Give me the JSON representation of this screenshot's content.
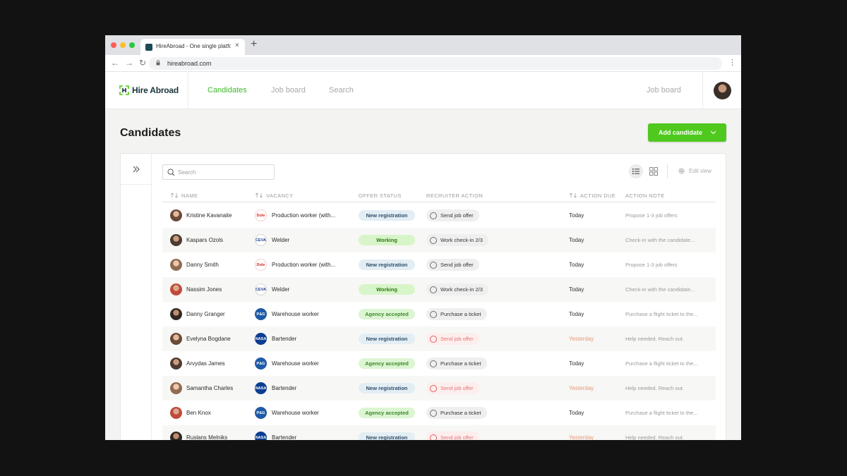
{
  "browser": {
    "tab_title": "HireAbroad - One single platform",
    "tab_close": "×",
    "new_tab": "+",
    "url": "hireabroad.com"
  },
  "app": {
    "logo": "Hire Abroad",
    "nav": [
      "Candidates",
      "Job board",
      "Search"
    ],
    "nav_right": "Job board"
  },
  "page": {
    "title": "Candidates",
    "add_button": "Add candidate"
  },
  "toolbar": {
    "search_placeholder": "Search",
    "edit_view": "Edit view"
  },
  "columns": [
    "NAME",
    "VACANCY",
    "OFFER STATUS",
    "RECRUITER ACTION",
    "ACTION DUE",
    "ACTION NOTE"
  ],
  "rows": [
    {
      "name": "Kristine Kavanaite",
      "company": "Dole",
      "vacancy": "Production worker (with...",
      "status": "New registration",
      "action": "Send job offer",
      "due": "Today",
      "note": "Propose 1-3 job offers"
    },
    {
      "name": "Kaspars Ozols",
      "company": "CEVA",
      "vacancy": "Welder",
      "status": "Working",
      "action": "Work check-in 2/3",
      "due": "Today",
      "note": "Check-in with the candidate..."
    },
    {
      "name": "Danny Smith",
      "company": "Dole",
      "vacancy": "Production worker (with...",
      "status": "New registration",
      "action": "Send job offer",
      "due": "Today",
      "note": "Propose 1-3 job offers"
    },
    {
      "name": "Nassim Jones",
      "company": "CEVA",
      "vacancy": "Welder",
      "status": "Working",
      "action": "Work check-in 2/3",
      "due": "Today",
      "note": "Check-in with the candidate..."
    },
    {
      "name": "Danny Granger",
      "company": "P&G",
      "vacancy": "Warehouse worker",
      "status": "Agency accepted",
      "action": "Purchase a ticket",
      "due": "Today",
      "note": "Purchase a flight ticket to the..."
    },
    {
      "name": "Evelyna Bogdane",
      "company": "NASA",
      "vacancy": "Bartender",
      "status": "New registration",
      "action": "Send job offer",
      "due": "Yesterday",
      "note": "Help needed. Reach out."
    },
    {
      "name": "Arvydas James",
      "company": "P&G",
      "vacancy": "Warehouse worker",
      "status": "Agency accepted",
      "action": "Purchase a ticket",
      "due": "Today",
      "note": "Purchase a flight ticket to the..."
    },
    {
      "name": "Samantha Charles",
      "company": "NASA",
      "vacancy": "Bartender",
      "status": "New registration",
      "action": "Send job offer",
      "due": "Yesterday",
      "note": "Help needed. Reach out."
    },
    {
      "name": "Ben Knox",
      "company": "P&G",
      "vacancy": "Warehouse worker",
      "status": "Agency accepted",
      "action": "Purchase a ticket",
      "due": "Today",
      "note": "Purchase a flight ticket to the..."
    },
    {
      "name": "Ruslans Melniks",
      "company": "NASA",
      "vacancy": "Bartender",
      "status": "New registration",
      "action": "Send job offer",
      "due": "Yesterday",
      "note": "Help needed. Reach out."
    }
  ],
  "colors": {
    "accent_green": "#4fc91d",
    "nav_active": "#3eb829",
    "warn_red": "#e25b5b",
    "status_new_bg": "#e3edf4",
    "status_working_bg": "#d8f5c9"
  },
  "icons": [
    "expand-sidebar-icon",
    "search-icon",
    "list-view-icon",
    "grid-view-icon",
    "gear-icon",
    "sort-icon",
    "chevron-down-icon"
  ]
}
